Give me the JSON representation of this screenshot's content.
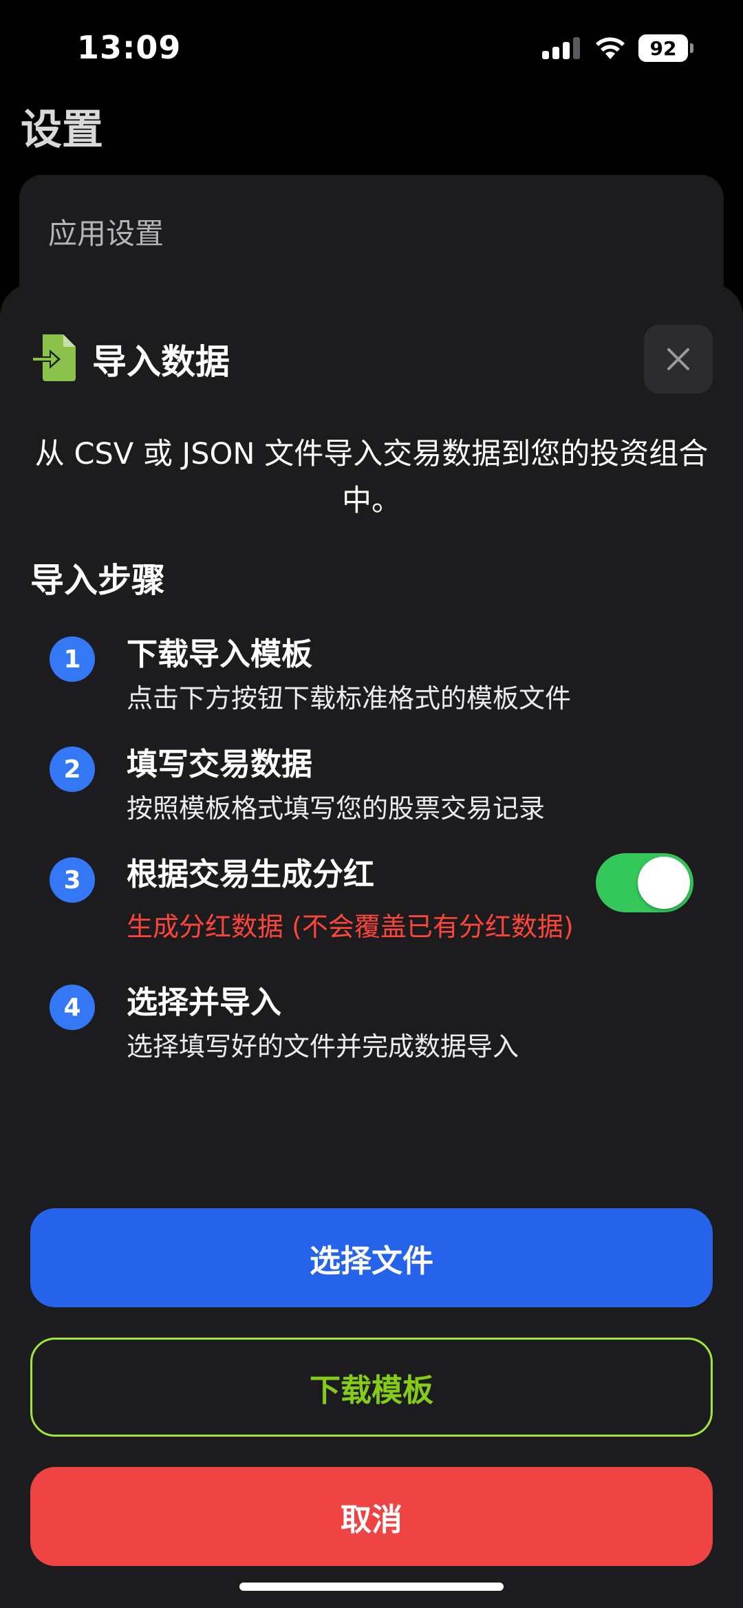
{
  "status_bar": {
    "time": "13:09",
    "battery": "92",
    "icons": [
      "signal-icon",
      "wifi-icon",
      "battery-icon"
    ]
  },
  "page": {
    "title": "设置",
    "card_label": "应用设置"
  },
  "sheet": {
    "title": "导入数据",
    "header_icon": "file-import-icon",
    "close_icon": "close-icon",
    "description": "从 CSV 或 JSON 文件导入交易数据到您的投资组合中。",
    "steps_heading": "导入步骤",
    "steps": [
      {
        "number": "1",
        "title": "下载导入模板",
        "subtitle": "点击下方按钮下载标准格式的模板文件"
      },
      {
        "number": "2",
        "title": "填写交易数据",
        "subtitle": "按照模板格式填写您的股票交易记录"
      },
      {
        "number": "3",
        "title": "根据交易生成分红",
        "subtitle": "生成分红数据 (不会覆盖已有分红数据)",
        "toggle_on": true
      },
      {
        "number": "4",
        "title": "选择并导入",
        "subtitle": "选择填写好的文件并完成数据导入"
      }
    ],
    "buttons": {
      "select_file": "选择文件",
      "download_template": "下载模板",
      "cancel": "取消"
    }
  },
  "colors": {
    "accent_blue": "#2563eb",
    "step_blue": "#3478f6",
    "toggle_green": "#34c759",
    "outline_green": "#a3e635",
    "danger_red": "#ef4444",
    "warning_red": "#ff453a",
    "icon_green": "#8bc34a"
  }
}
